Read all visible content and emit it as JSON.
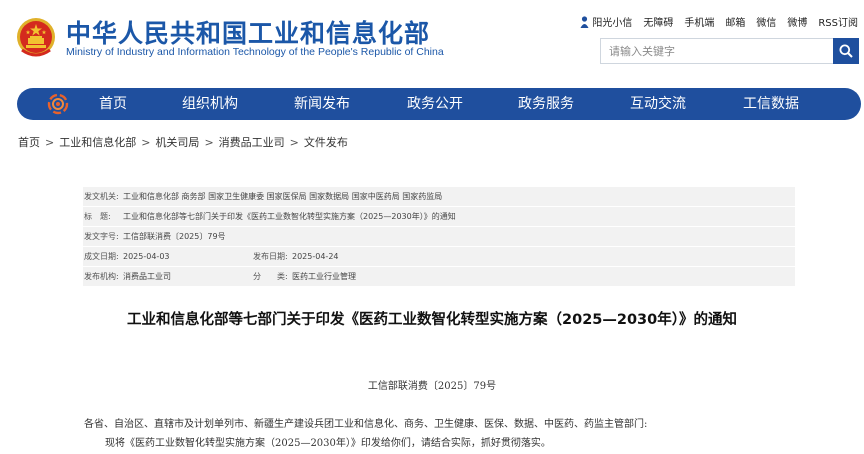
{
  "header": {
    "site_title": "中华人民共和国工业和信息化部",
    "site_subtitle": "Ministry of Industry and Information Technology of the People's Republic of China",
    "top_links": [
      "阳光小信",
      "无障碍",
      "手机端",
      "邮箱",
      "微信",
      "微博",
      "RSS订阅"
    ],
    "search_placeholder": "请输入关键字"
  },
  "nav": {
    "items": [
      "首页",
      "组织机构",
      "新闻发布",
      "政务公开",
      "政务服务",
      "互动交流",
      "工信数据"
    ]
  },
  "breadcrumb": [
    "首页",
    "工业和信息化部",
    "机关司局",
    "消费品工业司",
    "文件发布"
  ],
  "meta": {
    "issuer_label": "发文机关:",
    "issuer_value": "工业和信息化部 商务部 国家卫生健康委 国家医保局 国家数据局 国家中医药局 国家药监局",
    "title_label": "标　题:",
    "title_value": "工业和信息化部等七部门关于印发《医药工业数智化转型实施方案（2025—2030年）》的通知",
    "docno_label": "发文字号:",
    "docno_value": "工信部联消费〔2025〕79号",
    "date_label": "成文日期:",
    "date_value": "2025-04-03",
    "pubdate_label": "发布日期:",
    "pubdate_value": "2025-04-24",
    "org_label": "发布机构:",
    "org_value": "消费品工业司",
    "category_label": "分　　类:",
    "category_value": "医药工业行业管理"
  },
  "article": {
    "title": "工业和信息化部等七部门关于印发《医药工业数智化转型实施方案（2025—2030年）》的通知",
    "doc_number": "工信部联消费〔2025〕79号",
    "paragraph1": "各省、自治区、直辖市及计划单列市、新疆生产建设兵团工业和信息化、商务、卫生健康、医保、数据、中医药、药监主管部门:",
    "paragraph2": "现将《医药工业数智化转型实施方案（2025—2030年）》印发给你们，请结合实际，抓好贯彻落实。"
  },
  "colors": {
    "brand_blue": "#1b57a8",
    "nav_blue": "#1f4f9e",
    "meta_bg": "#f2f2f2",
    "emblem_red": "#d42a1e",
    "emblem_gold": "#f2c230"
  }
}
